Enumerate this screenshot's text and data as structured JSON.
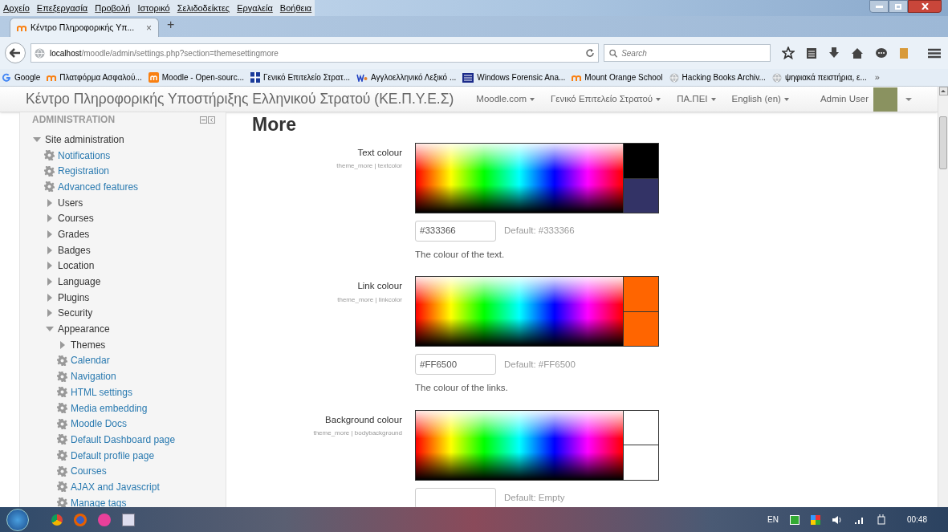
{
  "menu_bar": [
    "Αρχείο",
    "Επεξεργασία",
    "Προβολή",
    "Ιστορικό",
    "Σελιδοδείκτες",
    "Εργαλεία",
    "Βοήθεια"
  ],
  "tabs": [
    {
      "label": "Κέντρο Πληροφορικής Υπ...",
      "selected": true,
      "close": "×"
    }
  ],
  "new_tab": "+",
  "address": {
    "host": "localhost",
    "path": "/moodle/admin/settings.php?section=themesettingmore"
  },
  "search": {
    "placeholder": "Search"
  },
  "bookmarks": [
    {
      "label": "Google",
      "kind": "google"
    },
    {
      "label": "Πλατφόρμα Ασφαλού...",
      "kind": "moodle"
    },
    {
      "label": "Moodle - Open-sourc...",
      "kind": "moodlebox"
    },
    {
      "label": "Γενικό Επιτελείο Στρατ...",
      "kind": "flag"
    },
    {
      "label": "Αγγλοελληνικό Λεξικό ...",
      "kind": "wr"
    },
    {
      "label": "Windows Forensic Ana...",
      "kind": "book"
    },
    {
      "label": "Mount Orange School",
      "kind": "moodle"
    },
    {
      "label": "Hacking Books Archiv...",
      "kind": "globe"
    },
    {
      "label": "ψηφιακά πειστήρια, ε...",
      "kind": "globe"
    }
  ],
  "bookmarks_more": "»",
  "navbar": {
    "title": "Κέντρο Πληροφορικής Υποστήριξης Ελληνικού Στρατού (ΚΕ.Π.Υ.Ε.Σ)",
    "menus": [
      "Moodle.com",
      "Γενικό Επιτελείο Στρατού",
      "ΠΑ.ΠΕΙ",
      "English (en)"
    ],
    "user": "Admin User"
  },
  "sidebar": {
    "title": "ADMINISTRATION",
    "items": [
      {
        "label": "Site administration",
        "kind": "folder",
        "expanded": true,
        "children": [
          {
            "label": "Notifications",
            "kind": "link"
          },
          {
            "label": "Registration",
            "kind": "link"
          },
          {
            "label": "Advanced features",
            "kind": "link"
          },
          {
            "label": "Users",
            "kind": "folder",
            "expanded": false
          },
          {
            "label": "Courses",
            "kind": "folder",
            "expanded": false
          },
          {
            "label": "Grades",
            "kind": "folder",
            "expanded": false
          },
          {
            "label": "Badges",
            "kind": "folder",
            "expanded": false
          },
          {
            "label": "Location",
            "kind": "folder",
            "expanded": false
          },
          {
            "label": "Language",
            "kind": "folder",
            "expanded": false
          },
          {
            "label": "Plugins",
            "kind": "folder",
            "expanded": false
          },
          {
            "label": "Security",
            "kind": "folder",
            "expanded": false
          },
          {
            "label": "Appearance",
            "kind": "folder",
            "expanded": true,
            "children": [
              {
                "label": "Themes",
                "kind": "folder",
                "expanded": false
              },
              {
                "label": "Calendar",
                "kind": "link"
              },
              {
                "label": "Navigation",
                "kind": "link"
              },
              {
                "label": "HTML settings",
                "kind": "link"
              },
              {
                "label": "Media embedding",
                "kind": "link"
              },
              {
                "label": "Moodle Docs",
                "kind": "link"
              },
              {
                "label": "Default Dashboard page",
                "kind": "link"
              },
              {
                "label": "Default profile page",
                "kind": "link"
              },
              {
                "label": "Courses",
                "kind": "link"
              },
              {
                "label": "AJAX and Javascript",
                "kind": "link"
              },
              {
                "label": "Manage tags",
                "kind": "link"
              }
            ]
          }
        ]
      }
    ]
  },
  "heading": "More",
  "settings": [
    {
      "label": "Text colour",
      "config": "theme_more | textcolor",
      "swatches": [
        {
          "color": "#000000"
        },
        {
          "color": "#333366"
        }
      ],
      "value": "#333366",
      "default": "Default: #333366",
      "description": "The colour of the text."
    },
    {
      "label": "Link colour",
      "config": "theme_more | linkcolor",
      "swatches": [
        {
          "color": "#ff6500"
        },
        {
          "color": "#ff6500"
        }
      ],
      "value": "#FF6500",
      "default": "Default: #FF6500",
      "description": "The colour of the links."
    },
    {
      "label": "Background colour",
      "config": "theme_more | bodybackground",
      "swatches": [
        {
          "color": "#ffffff"
        },
        {
          "color": "#ffffff"
        }
      ],
      "default": "Default: Empty"
    }
  ],
  "taskbar": {
    "language": "EN",
    "time": "00:48"
  }
}
